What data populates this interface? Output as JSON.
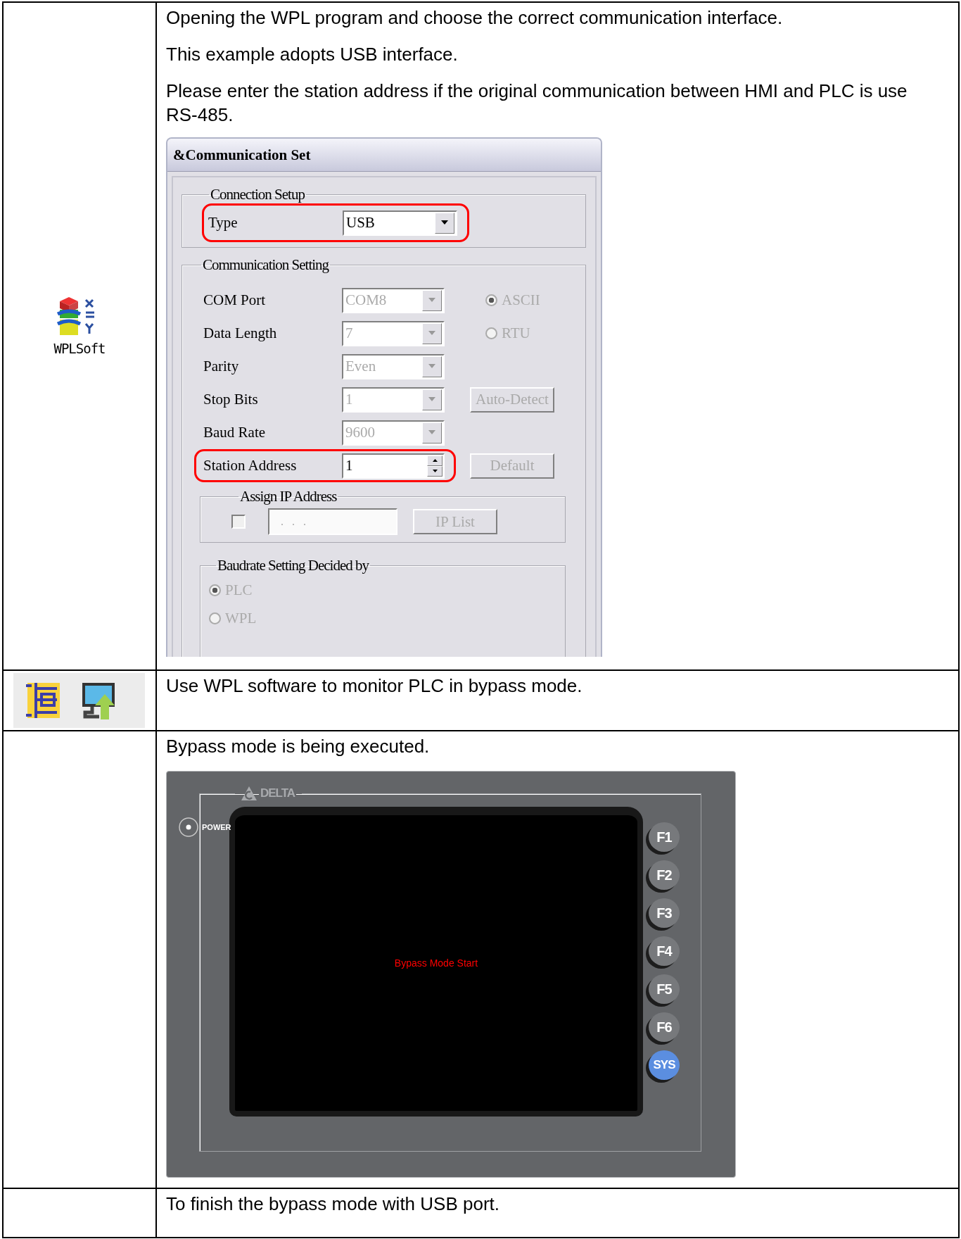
{
  "rows": [
    {
      "kind": "app",
      "app_label": "WPLSoft",
      "paragraphs": [
        "Opening the WPL program and choose the correct communication interface.",
        "This example adopts USB interface.",
        "Please enter the station address if the original communication between HMI and PLC is use RS-485."
      ],
      "dialog": {
        "title": "&Communication Set",
        "connection_setup": {
          "legend": "Connection Setup",
          "label": "Type",
          "value": "USB",
          "highlighted": true
        },
        "communication_setting": {
          "legend": "Communication Setting",
          "fields": [
            {
              "label": "COM Port",
              "value": "COM8",
              "kind": "dropdown",
              "disabled": true
            },
            {
              "label": "Data Length",
              "value": "7",
              "kind": "dropdown",
              "disabled": true
            },
            {
              "label": "Parity",
              "value": "Even",
              "kind": "dropdown",
              "disabled": true
            },
            {
              "label": "Stop Bits",
              "value": "1",
              "kind": "dropdown",
              "disabled": true
            },
            {
              "label": "Baud Rate",
              "value": "9600",
              "kind": "dropdown",
              "disabled": true
            },
            {
              "label": "Station Address",
              "value": "1",
              "kind": "spinner",
              "disabled": false,
              "highlighted": true
            }
          ],
          "modes": [
            {
              "label": "ASCII",
              "selected": true,
              "disabled": true
            },
            {
              "label": "RTU",
              "selected": false,
              "disabled": true
            }
          ],
          "buttons": [
            {
              "label": "Auto-Detect",
              "disabled": true
            },
            {
              "label": "Default",
              "disabled": true
            }
          ]
        },
        "assign_ip": {
          "legend": "Assign IP Address",
          "checked": false,
          "value": ".   .   .",
          "button": {
            "label": "IP List",
            "disabled": true
          }
        },
        "baudrate": {
          "legend": "Baudrate Setting Decided by",
          "options": [
            {
              "label": "PLC",
              "selected": true,
              "disabled": true
            },
            {
              "label": "WPL",
              "selected": false,
              "disabled": true
            }
          ]
        }
      }
    },
    {
      "kind": "toolbar",
      "paragraphs": [
        "Use WPL software to monitor PLC in bypass mode."
      ]
    },
    {
      "kind": "device",
      "paragraphs": [
        "Bypass mode is being executed."
      ],
      "device": {
        "brand": "DELTA",
        "power_label": "POWER",
        "screen_message": "Bypass Mode Start",
        "keys": [
          {
            "label": "F1",
            "kind": "function"
          },
          {
            "label": "F2",
            "kind": "function"
          },
          {
            "label": "F3",
            "kind": "function"
          },
          {
            "label": "F4",
            "kind": "function"
          },
          {
            "label": "F5",
            "kind": "function"
          },
          {
            "label": "F6",
            "kind": "function"
          },
          {
            "label": "SYS",
            "kind": "system"
          }
        ]
      }
    },
    {
      "kind": "blank",
      "paragraphs": [
        "To finish the bypass mode with USB port."
      ]
    }
  ]
}
